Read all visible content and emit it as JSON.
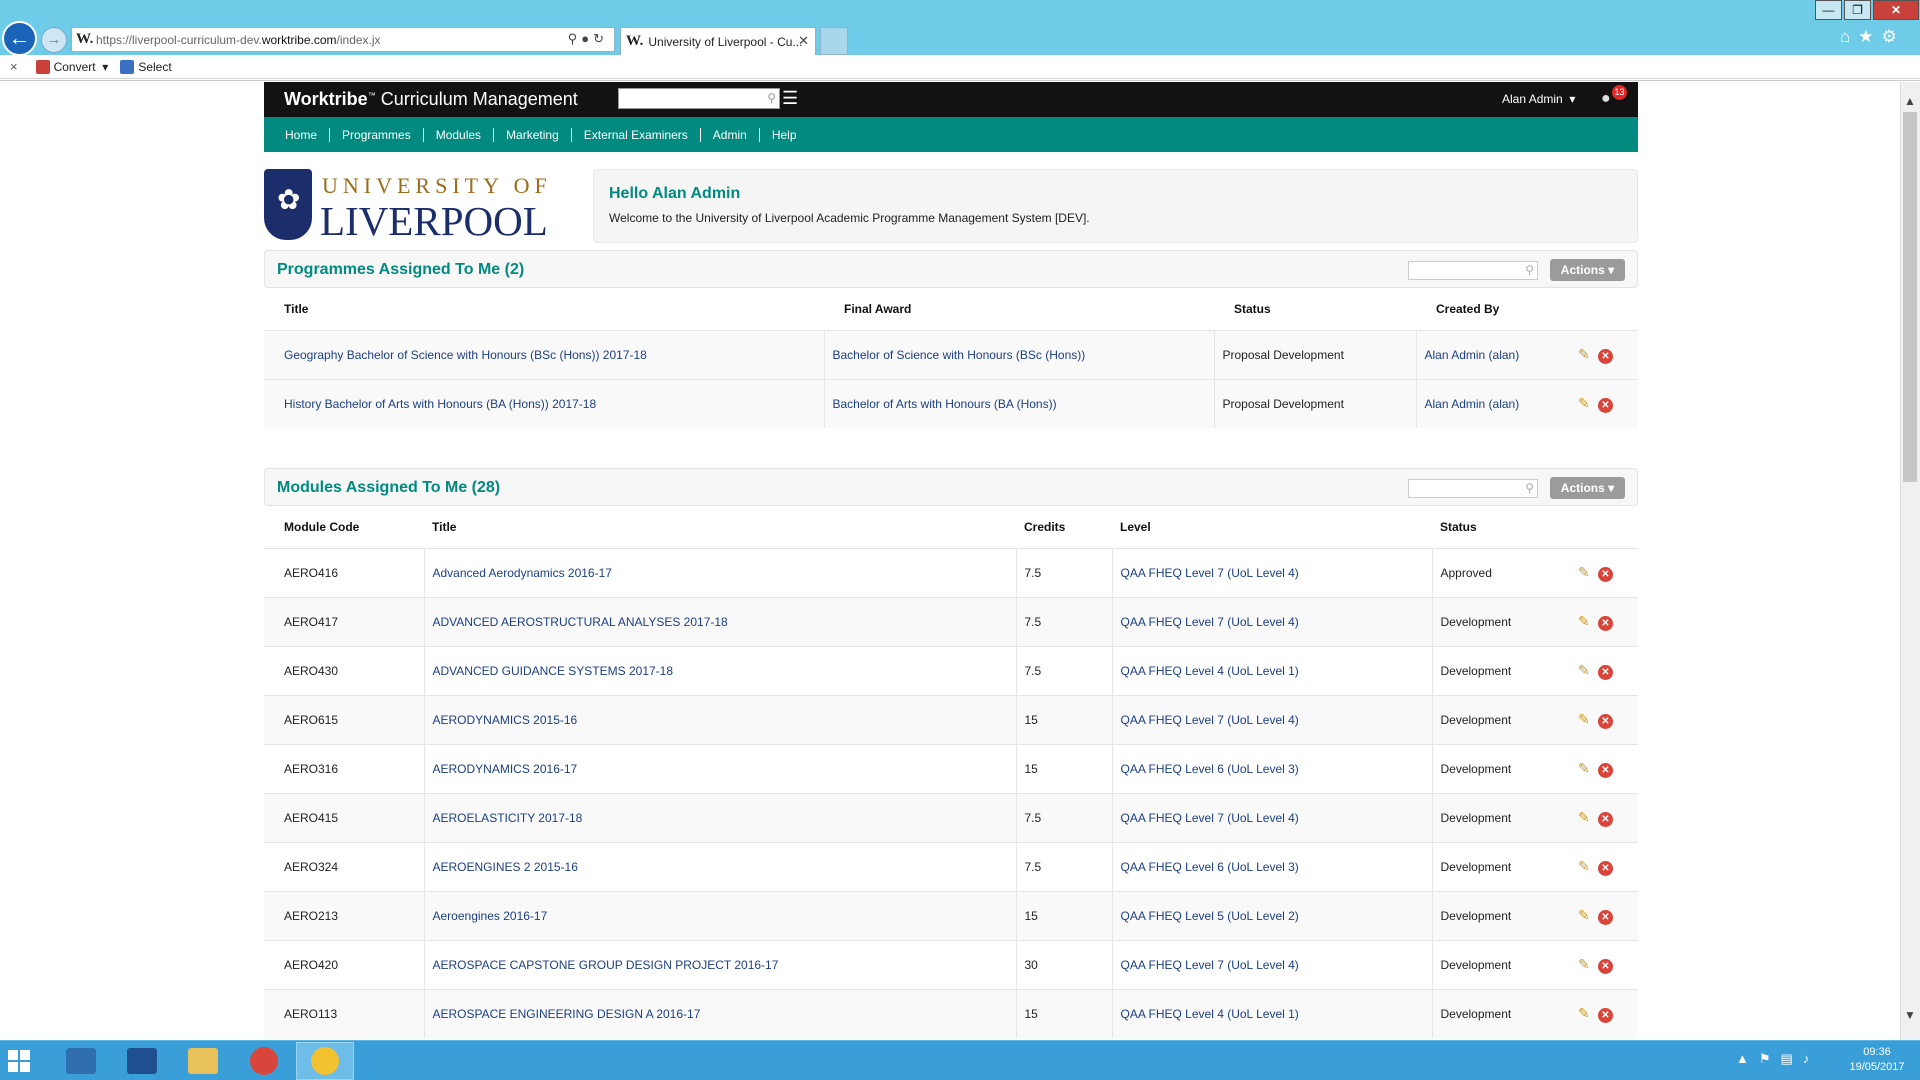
{
  "browser": {
    "url_prefix": "https://liverpool-curriculum-dev.",
    "url_domain": "worktribe.com",
    "url_suffix": "/index.jx",
    "tab_title": "University of Liverpool - Cu...",
    "favicon": "W.",
    "window_controls": [
      "—",
      "❐",
      "✕"
    ]
  },
  "command_bar": {
    "close": "×",
    "convert": "Convert",
    "select": "Select"
  },
  "app": {
    "brand_name": "Worktribe",
    "brand_tm": "™",
    "brand_suffix": " Curriculum Management",
    "user": "Alan Admin",
    "notifications": "13",
    "nav": [
      "Home",
      "Programmes",
      "Modules",
      "Marketing",
      "External Examiners",
      "Admin",
      "Help"
    ]
  },
  "logo": {
    "line1": "UNIVERSITY OF",
    "line2": "LIVERPOOL"
  },
  "welcome": {
    "title": "Hello Alan Admin",
    "text": "Welcome to the University of Liverpool Academic Programme Management System [DEV]."
  },
  "programmes": {
    "title": "Programmes Assigned To Me (2)",
    "actions_label": "Actions",
    "columns": [
      "Title",
      "Final Award",
      "Status",
      "Created By"
    ],
    "rows": [
      [
        "Geography Bachelor of Science with Honours (BSc (Hons)) 2017-18",
        "Bachelor of Science with Honours (BSc (Hons))",
        "Proposal Development",
        "Alan Admin (alan)"
      ],
      [
        "History Bachelor of Arts with Honours (BA (Hons)) 2017-18",
        "Bachelor of Arts with Honours (BA (Hons))",
        "Proposal Development",
        "Alan Admin (alan)"
      ]
    ]
  },
  "modules": {
    "title": "Modules Assigned To Me (28)",
    "actions_label": "Actions",
    "columns": [
      "Module Code",
      "Title",
      "Credits",
      "Level",
      "Status"
    ],
    "rows": [
      [
        "AERO416",
        "Advanced Aerodynamics 2016-17",
        "7.5",
        "QAA FHEQ Level 7 (UoL Level 4)",
        "Approved"
      ],
      [
        "AERO417",
        "ADVANCED AEROSTRUCTURAL ANALYSES 2017-18",
        "7.5",
        "QAA FHEQ Level 7 (UoL Level 4)",
        "Development"
      ],
      [
        "AERO430",
        "ADVANCED GUIDANCE SYSTEMS 2017-18",
        "7.5",
        "QAA FHEQ Level 4 (UoL Level 1)",
        "Development"
      ],
      [
        "AERO615",
        "AERODYNAMICS 2015-16",
        "15",
        "QAA FHEQ Level 7 (UoL Level 4)",
        "Development"
      ],
      [
        "AERO316",
        "AERODYNAMICS 2016-17",
        "15",
        "QAA FHEQ Level 6 (UoL Level 3)",
        "Development"
      ],
      [
        "AERO415",
        "AEROELASTICITY 2017-18",
        "7.5",
        "QAA FHEQ Level 7 (UoL Level 4)",
        "Development"
      ],
      [
        "AERO324",
        "AEROENGINES 2 2015-16",
        "7.5",
        "QAA FHEQ Level 6 (UoL Level 3)",
        "Development"
      ],
      [
        "AERO213",
        "Aeroengines 2016-17",
        "15",
        "QAA FHEQ Level 5 (UoL Level 2)",
        "Development"
      ],
      [
        "AERO420",
        "AEROSPACE CAPSTONE GROUP DESIGN PROJECT 2016-17",
        "30",
        "QAA FHEQ Level 7 (UoL Level 4)",
        "Development"
      ],
      [
        "AERO113",
        "AEROSPACE ENGINEERING DESIGN A 2016-17",
        "15",
        "QAA FHEQ Level 4 (UoL Level 1)",
        "Development"
      ]
    ]
  },
  "taskbar": {
    "time": "09:36",
    "date": "19/05/2017"
  },
  "icons": {
    "search": "search-icon",
    "menu": "hamburger-menu-icon",
    "edit": "pencil-icon",
    "delete": "delete-icon",
    "chat": "chat-icon"
  },
  "colors": {
    "teal": "#008a80",
    "link": "#1d3f82",
    "topbar": "#121212",
    "chrome": "#6fcce9",
    "taskbar": "#3a9fd8"
  }
}
